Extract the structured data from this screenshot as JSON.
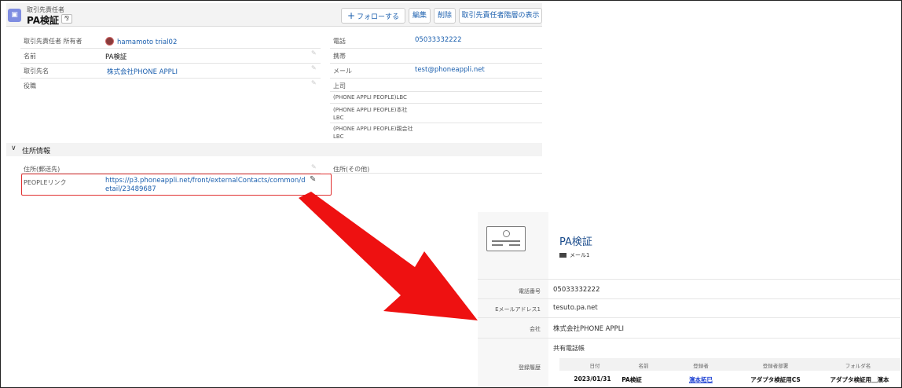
{
  "record_header": {
    "object_type": "取引先責任者",
    "title": "PA検証",
    "object_icon": "contact-card-icon",
    "buttons": {
      "follow": "フォローする",
      "edit": "編集",
      "delete": "削除",
      "hierarchy": "取引先責任者階層の表示"
    }
  },
  "fields_left": [
    {
      "label": "取引先責任者 所有者",
      "value": "hamamoto trial02"
    },
    {
      "label": "名前",
      "value": "PA検証"
    },
    {
      "label": "取引先名",
      "value": "株式会社PHONE APPLI"
    },
    {
      "label": "役職",
      "value": ""
    }
  ],
  "fields_right": [
    {
      "label": "電話",
      "value": "05033332222"
    },
    {
      "label": "携帯",
      "value": ""
    },
    {
      "label": "メール",
      "value": "test@phoneappli.net"
    },
    {
      "label": "上司",
      "value": ""
    },
    {
      "label": "(PHONE APPLI PEOPLE)LBC",
      "value": ""
    },
    {
      "label": "(PHONE APPLI PEOPLE)本社LBC",
      "value": ""
    },
    {
      "label": "(PHONE APPLI PEOPLE)親会社LBC",
      "value": ""
    }
  ],
  "address_section": {
    "title": "住所情報",
    "mailing_label": "住所(郵送先)",
    "other_label": "住所(その他)",
    "people_link_label": "PEOPLEリンク",
    "people_link_value": "https://p3.phoneappli.net/front/externalContacts/common/detail/23489687"
  },
  "phone_appli": {
    "name": "PA検証",
    "mail_label": "メール1",
    "rows": [
      {
        "label": "電話番号",
        "value": "05033332222"
      },
      {
        "label": "Eメールアドレス1",
        "value": "tesuto.pa.net"
      },
      {
        "label": "会社",
        "value": "株式会社PHONE APPLI"
      }
    ],
    "history_label": "登録履歴",
    "shared_title": "共有電話帳",
    "table": {
      "headers": [
        "日付",
        "名前",
        "登録者",
        "登録者部署",
        "フォルダ名"
      ],
      "row": [
        "2023/01/31",
        "PA検証",
        "濱本拓巳",
        "アダプタ検証用CS",
        "アダプタ検証用＿濱本"
      ]
    }
  },
  "colors": {
    "link": "#1b5fae",
    "highlight_box": "#e03030",
    "arrow": "#ee1111"
  }
}
